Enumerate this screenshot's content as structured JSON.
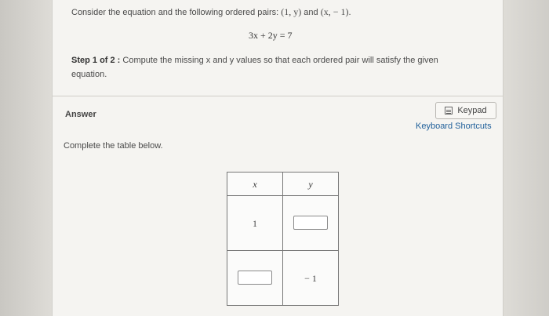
{
  "question": {
    "intro": "Consider the equation and the following ordered pairs: ",
    "pair1": "(1, y)",
    "and": " and ",
    "pair2": "(x, − 1)",
    "end": ".",
    "equation": "3x + 2y = 7"
  },
  "step": {
    "label": "Step 1 of 2 :",
    "text": " Compute the missing x and y values so that each ordered pair will satisfy the given equation."
  },
  "answer": {
    "label": "Answer",
    "keypad_label": "Keypad",
    "shortcuts_label": "Keyboard Shortcuts",
    "instruction": "Complete the table below."
  },
  "table": {
    "header_x": "x",
    "header_y": "y",
    "row1_x": "1",
    "row1_y": "",
    "row2_x": "",
    "row2_y": "− 1"
  }
}
